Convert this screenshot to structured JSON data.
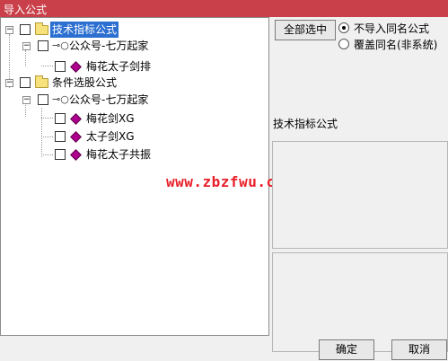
{
  "window": {
    "title": "导入公式"
  },
  "tree": {
    "nodes": [
      {
        "label": "技术指标公式",
        "expander": "⊟"
      },
      {
        "label": "公众号-七万起家",
        "expander": "⊟"
      },
      {
        "label": "梅花太子剑排"
      },
      {
        "label": "条件选股公式",
        "expander": "⊟"
      },
      {
        "label": "公众号-七万起家",
        "expander": "⊟"
      },
      {
        "label": "梅花剑XG"
      },
      {
        "label": "太子剑XG"
      },
      {
        "label": "梅花太子共振"
      }
    ]
  },
  "options": {
    "select_all_label": "全部选中",
    "radio_no_import_label": "不导入同名公式",
    "radio_overwrite_label": "覆盖同名(非系统)",
    "selected_radio": "不导入同名公式"
  },
  "formula_section": {
    "title": "技术指标公式"
  },
  "watermark": {
    "text": "www.zbzfwu.com"
  },
  "footer": {
    "ok_label": "确定",
    "cancel_label": "取消"
  },
  "colors": {
    "titlebar": "#c9404a",
    "selection": "#2b6fd0",
    "watermark": "#e8202a",
    "formula_icon": "#b0008f"
  }
}
